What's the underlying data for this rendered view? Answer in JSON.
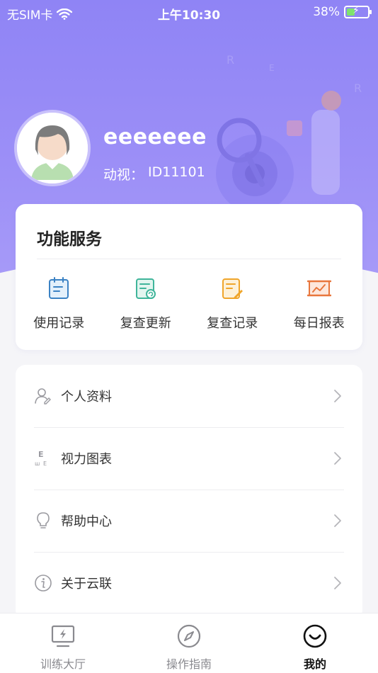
{
  "status": {
    "carrier": "无SIM卡",
    "time": "上午10:30",
    "battery_percent": "38%",
    "battery_level": 0.38
  },
  "profile": {
    "username": "eeeeeee",
    "id_label": "动视：",
    "id_value": "ID11101"
  },
  "services": {
    "title": "功能服务",
    "items": [
      {
        "label": "使用记录",
        "icon": "calendar-icon",
        "color": "#3b82c4"
      },
      {
        "label": "复查更新",
        "icon": "refresh-doc-icon",
        "color": "#3fb59a"
      },
      {
        "label": "复查记录",
        "icon": "edit-doc-icon",
        "color": "#f0a52a"
      },
      {
        "label": "每日报表",
        "icon": "report-chart-icon",
        "color": "#e8763c"
      }
    ]
  },
  "menu": {
    "items": [
      {
        "label": "个人资料",
        "icon": "user-icon"
      },
      {
        "label": "视力图表",
        "icon": "eye-chart-icon"
      },
      {
        "label": "帮助中心",
        "icon": "lightbulb-icon"
      },
      {
        "label": "关于云联",
        "icon": "info-icon"
      }
    ]
  },
  "tabbar": {
    "tabs": [
      {
        "label": "训练大厅",
        "icon": "monitor-bolt-icon",
        "active": false
      },
      {
        "label": "操作指南",
        "icon": "compass-icon",
        "active": false
      },
      {
        "label": "我的",
        "icon": "smile-icon",
        "active": true
      }
    ]
  },
  "colors": {
    "hero_top": "#8f84f5",
    "hero_bottom": "#a89cf8",
    "active_tab": "#111111"
  }
}
